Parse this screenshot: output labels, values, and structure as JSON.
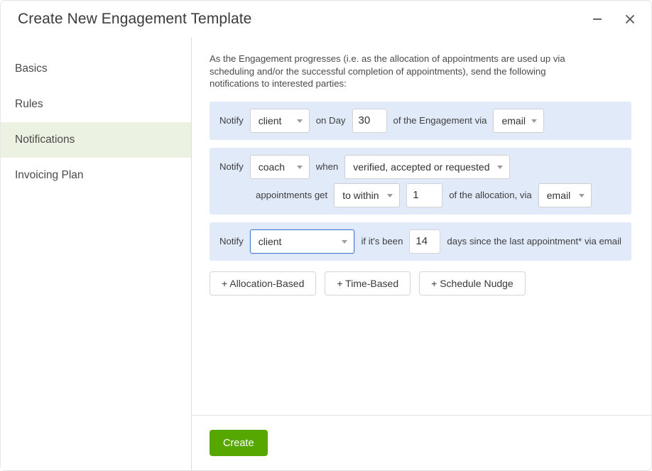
{
  "window": {
    "title": "Create New Engagement Template",
    "minimize_icon": "minimize-icon",
    "close_icon": "close-icon"
  },
  "sidebar": {
    "items": [
      {
        "label": "Basics",
        "active": false
      },
      {
        "label": "Rules",
        "active": false
      },
      {
        "label": "Notifications",
        "active": true
      },
      {
        "label": "Invoicing Plan",
        "active": false
      }
    ]
  },
  "main": {
    "intro": "As the Engagement progresses (i.e. as the allocation of appointments are used up via scheduling and/or the successful completion of appointments), send the following notifications to interested parties:",
    "notifications": [
      {
        "type": "time-based",
        "label_notify": "Notify",
        "recipient": "client",
        "label_on_day": "on Day",
        "day_value": "30",
        "label_tail": "of the Engagement via",
        "channel": "email"
      },
      {
        "type": "allocation-based",
        "label_notify": "Notify",
        "recipient": "coach",
        "label_when": "when",
        "condition": "verified, accepted or requested",
        "label_appointments_get": "appointments get",
        "comparator": "to within",
        "amount_value": "1",
        "label_of_allocation": "of the allocation, via",
        "channel": "email"
      },
      {
        "type": "schedule-nudge",
        "label_notify": "Notify",
        "recipient": "client",
        "recipient_focused": true,
        "label_if_been": "if it's been",
        "days_value": "14",
        "label_tail": "days since the last appointment* via email"
      }
    ],
    "add_buttons": [
      {
        "label": "+ Allocation-Based"
      },
      {
        "label": "+ Time-Based"
      },
      {
        "label": "+ Schedule Nudge"
      }
    ]
  },
  "footer": {
    "create_label": "Create"
  },
  "colors": {
    "notification_bg": "#e0eaf8",
    "sidebar_active_bg": "#ebf2e2",
    "create_button": "#56a700",
    "focus_border": "#4a7fd4"
  }
}
